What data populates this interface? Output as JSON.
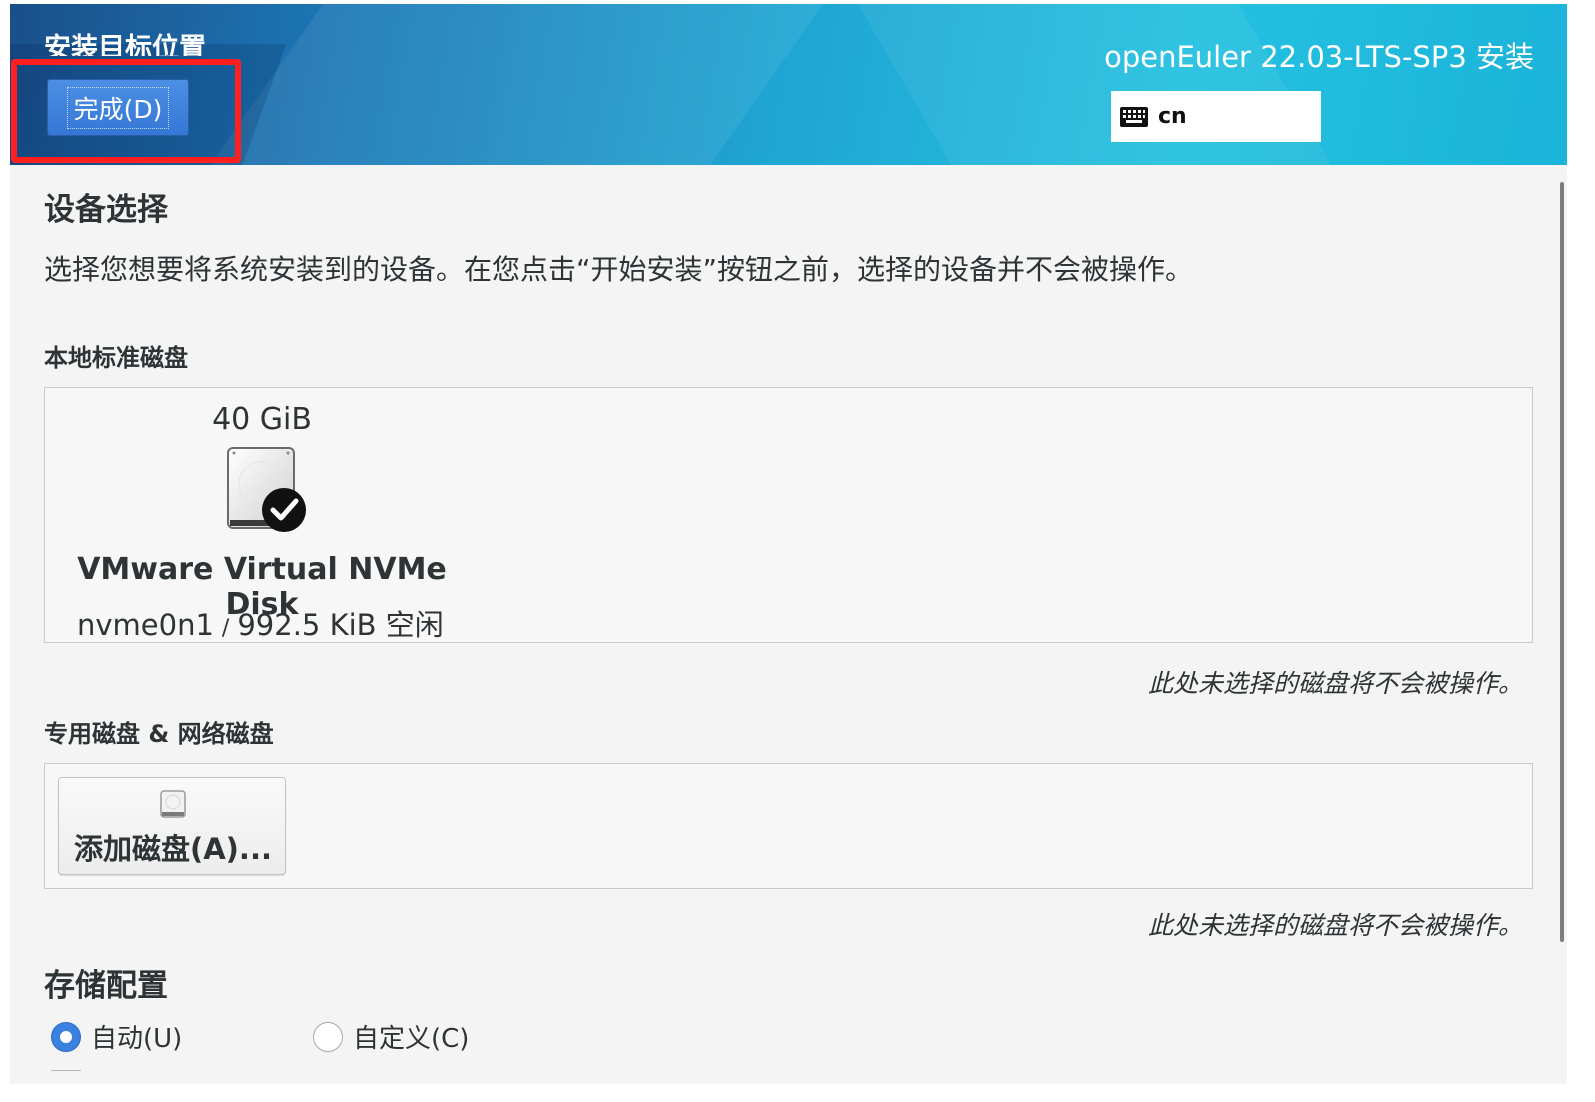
{
  "header": {
    "spoke_title": "安装目标位置",
    "done_button_label": "完成(D)",
    "product_title": "openEuler 22.03-LTS-SP3 安装",
    "keyboard_layout": "cn"
  },
  "device_selection": {
    "title": "设备选择",
    "description": "选择您想要将系统安装到的设备。在您点击“开始安装”按钮之前，选择的设备并不会被操作。"
  },
  "local_disks": {
    "title": "本地标准磁盘",
    "disks": [
      {
        "size": "40 GiB",
        "name": "VMware Virtual NVMe Disk",
        "device": "nvme0n1",
        "separator": "/",
        "free": "992.5 KiB 空闲",
        "selected": true,
        "icon": "hard-disk-icon"
      }
    ],
    "note": "此处未选择的磁盘将不会被操作。"
  },
  "special_disks": {
    "title": "专用磁盘 & 网络磁盘",
    "add_button_label": "添加磁盘(A)...",
    "add_button_icon": "small-disk-icon",
    "note": "此处未选择的磁盘将不会被操作。"
  },
  "storage_config": {
    "title": "存储配置",
    "options": [
      {
        "label": "自动(U)",
        "selected": true
      },
      {
        "label": "自定义(C)",
        "selected": false
      }
    ]
  },
  "colors": {
    "accent": "#3b82e0",
    "highlight_box": "#ff1f1f",
    "header_gradient_start": "#1a4f8a",
    "header_gradient_end": "#25c1e1"
  }
}
